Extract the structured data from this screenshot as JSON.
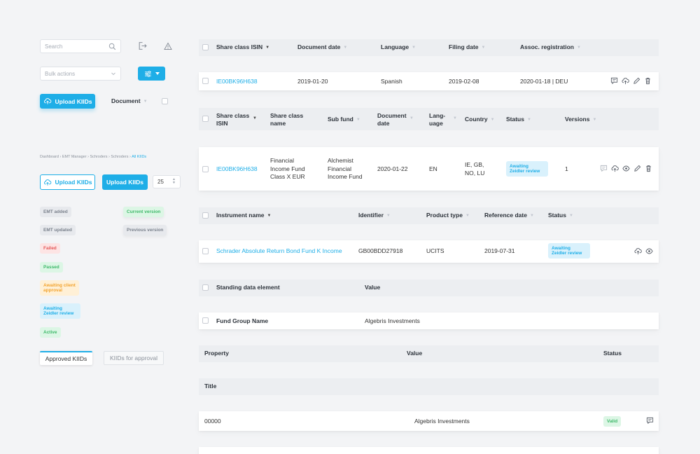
{
  "sidebar": {
    "search_placeholder": "Search",
    "bulk_actions_placeholder": "Bulk actions",
    "upload_kiids_label": "Upload KIIDs",
    "document_label": "Document",
    "breadcrumb": [
      "Dashboard",
      "EMT Manager",
      "Schroders",
      "Schroders",
      "All KIIDs"
    ],
    "upload_kiids_outline_label": "Upload KIIDs",
    "upload_kiids_primary_label": "Upload KIIDs",
    "page_size": "25",
    "badges": {
      "emt_added": "EMT added",
      "emt_updated": "EMT updated",
      "failed": "Failed",
      "passed": "Passed",
      "awaiting_client": "Awaiting client approval",
      "awaiting_zeidler": "Awaiting Zeidler review",
      "active": "Active",
      "current_version": "Current version",
      "previous_version": "Previous version"
    },
    "tabs": [
      "Approved KIIDs",
      "KIIDs for approval"
    ]
  },
  "table1": {
    "headers": [
      "Share class ISIN",
      "Document date",
      "Language",
      "Filing date",
      "Assoc. registration"
    ],
    "row": {
      "isin": "IE00BK96H638",
      "doc_date": "2019-01-20",
      "language": "Spanish",
      "filing_date": "2019-02-08",
      "assoc": "2020-01-18 | DEU"
    }
  },
  "table2": {
    "headers": {
      "isin": "Share class ISIN",
      "name": "Share class name",
      "sub_fund": "Sub fund",
      "doc_date": "Document date",
      "lang": "Lang-uage",
      "country": "Country",
      "status": "Status",
      "versions": "Versions"
    },
    "row": {
      "isin": "IE00BK96H638",
      "name": "Financial Income Fund Class X EUR",
      "sub_fund": "Alchemist Financial Income Fund",
      "doc_date": "2020-01-22",
      "lang": "EN",
      "country": "IE, GB, NO, LU",
      "status": "Awaiting Zeidler review",
      "versions": "1"
    }
  },
  "table3": {
    "headers": [
      "Instrument name",
      "Identifier",
      "Product type",
      "Reference date",
      "Status"
    ],
    "row": {
      "name": "Schrader Absolute Return Bond Fund K Income",
      "identifier": "GB00BDD27918",
      "type": "UCITS",
      "ref_date": "2019-07-31",
      "status": "Awaiting Zeidler review"
    }
  },
  "table4": {
    "headers": [
      "Standing data element",
      "Value"
    ],
    "row": {
      "element": "Fund Group Name",
      "value": "Algebris Investments"
    }
  },
  "table5": {
    "headers": [
      "Property",
      "Value",
      "Status"
    ],
    "section": "Title",
    "row": {
      "property": "00000",
      "value": "Algebris Investments",
      "status": "Valid"
    }
  },
  "colors": {
    "accent": "#1eaee7",
    "bg": "#f3f4f6"
  }
}
